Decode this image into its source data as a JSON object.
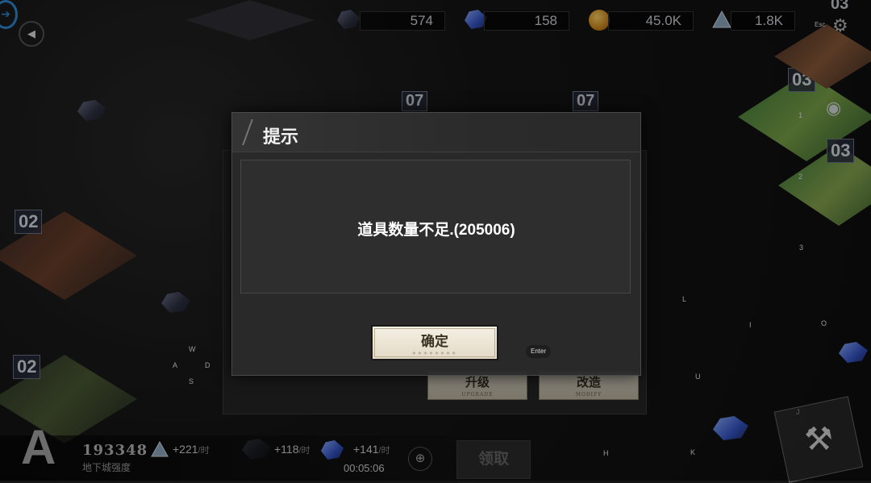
{
  "resources": [
    {
      "name": "dark-crystal",
      "value": "574"
    },
    {
      "name": "blue-crystal",
      "value": "158"
    },
    {
      "name": "gold",
      "value": "45.0K"
    },
    {
      "name": "prism",
      "value": "1.8K"
    }
  ],
  "hud": {
    "esc_label": "Esc",
    "floor_badge": "03"
  },
  "map": {
    "tile_labels": [
      "02",
      "02",
      "03",
      "03"
    ],
    "unit_levels": [
      "07",
      "07"
    ],
    "slot_numbers": [
      "1",
      "2",
      "3"
    ]
  },
  "keys": {
    "w": "W",
    "a": "A",
    "s": "S",
    "d": "D",
    "l": "L",
    "i": "I",
    "o": "O",
    "u": "U",
    "j": "J",
    "h": "H",
    "k": "K"
  },
  "underlying": {
    "upgrade": "升级",
    "upgrade_sub": "UPGRADE",
    "modify": "改造",
    "modify_sub": "MODIFY"
  },
  "dialog": {
    "title": "提示",
    "message": "道具数量不足.(205006)",
    "confirm": "确定",
    "confirm_deco": "✧✧✧✧✧✧✧✧",
    "enter_hint": "Enter"
  },
  "bottom": {
    "grade": "A",
    "power": "193348",
    "power_label": "地下城强度",
    "rate1": "+221",
    "rate2": "+118",
    "rate3": "+141",
    "per_hour": "/时",
    "timer": "00:05:06",
    "collect": "领取"
  },
  "colors": {
    "accent_blue": "#2e8bd6",
    "dialog_bg": "#2a2a2a",
    "button_cream": "#efe8d7"
  }
}
